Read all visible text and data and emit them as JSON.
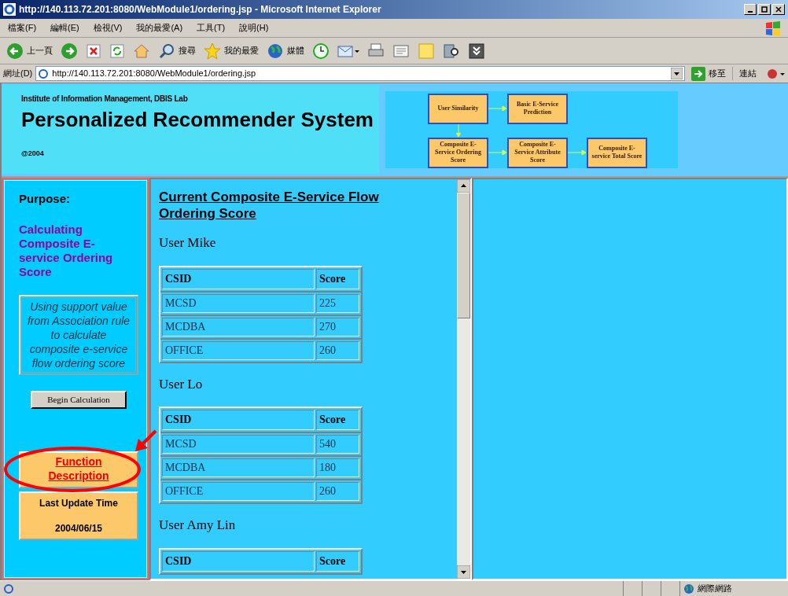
{
  "window": {
    "title": "http://140.113.72.201:8080/WebModule1/ordering.jsp - Microsoft Internet Explorer"
  },
  "menu": [
    "檔案(F)",
    "編輯(E)",
    "檢視(V)",
    "我的最愛(A)",
    "工具(T)",
    "說明(H)"
  ],
  "toolbar": [
    {
      "kind": "back",
      "label": "上一頁"
    },
    {
      "kind": "forward"
    },
    {
      "kind": "stop"
    },
    {
      "kind": "refresh"
    },
    {
      "kind": "home"
    },
    {
      "kind": "search",
      "label": "搜尋"
    },
    {
      "kind": "favorites",
      "label": "我的最愛"
    },
    {
      "kind": "media",
      "label": "媒體"
    },
    {
      "kind": "history"
    },
    {
      "kind": "mail"
    },
    {
      "kind": "print"
    },
    {
      "kind": "edit"
    },
    {
      "kind": "note"
    },
    {
      "kind": "research"
    },
    {
      "kind": "messenger"
    }
  ],
  "address": {
    "label": "網址(D)",
    "value": "http://140.113.72.201:8080/WebModule1/ordering.jsp",
    "go": "移至",
    "links": "連結"
  },
  "banner": {
    "org": "Institute of Information Management, DBIS Lab",
    "title": "Personalized Recommender System",
    "year": "@2004",
    "diagram": [
      [
        "User Similarity",
        "Basic E-Service Prediction"
      ],
      [
        "Composite E-Service Ordering Score",
        "Composite E-Service Attribute Score",
        "Composite E-service Total Score"
      ]
    ]
  },
  "sidebar": {
    "purpose_label": "Purpose:",
    "purpose": "Calculating Composite E-service Ordering Score",
    "description": "Using support value from Association rule to calculate composite e-service flow ordering score",
    "button": "Begin Calculation",
    "function_link": "Function Description",
    "update_label": "Last Update Time",
    "update_date": "2004/06/15"
  },
  "main": {
    "heading": "Current Composite E-Service Flow Ordering Score",
    "users": [
      {
        "name": "User Mike",
        "columns": [
          "CSID",
          "Score"
        ],
        "rows": [
          [
            "MCSD",
            "225"
          ],
          [
            "MCDBA",
            "270"
          ],
          [
            "OFFICE",
            "260"
          ]
        ]
      },
      {
        "name": "User Lo",
        "columns": [
          "CSID",
          "Score"
        ],
        "rows": [
          [
            "MCSD",
            "540"
          ],
          [
            "MCDBA",
            "180"
          ],
          [
            "OFFICE",
            "260"
          ]
        ]
      },
      {
        "name": "User Amy Lin",
        "columns": [
          "CSID",
          "Score"
        ]
      }
    ]
  },
  "status": {
    "zone": "網際網路"
  }
}
